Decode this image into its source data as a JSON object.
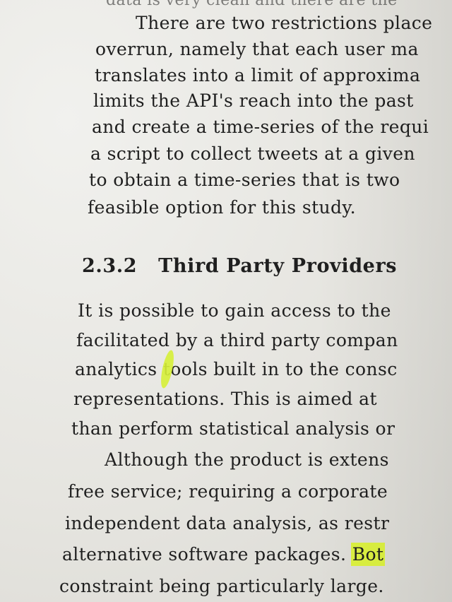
{
  "page": {
    "top_cut_line": "data is very clean and there are the",
    "para1": [
      "There are two restrictions place",
      "overrun, namely that each user ma",
      "translates into a limit of approxima",
      "limits the API's reach into the past",
      "and create a time-series of the requi",
      "a script to collect tweets at a given",
      "to obtain a time-series that is two",
      "feasible option for this study."
    ],
    "section": {
      "number": "2.3.2",
      "title": "Third Party Providers"
    },
    "para2": [
      "It is possible to gain access to the",
      "facilitated by a third party compan",
      "analytics tools built in to the consc",
      "representations. This is aimed at",
      "than perform statistical analysis or"
    ],
    "para3": [
      "Although the product is extens",
      "free service; requiring a corporate",
      "independent data analysis, as restr",
      "alternative software packages.",
      "constraint being particularly large."
    ],
    "para3_highlight": "Bot",
    "colors": {
      "highlighter": "#dcf141",
      "paper": "#e7e6e1",
      "ink": "#1f1f1f"
    }
  }
}
